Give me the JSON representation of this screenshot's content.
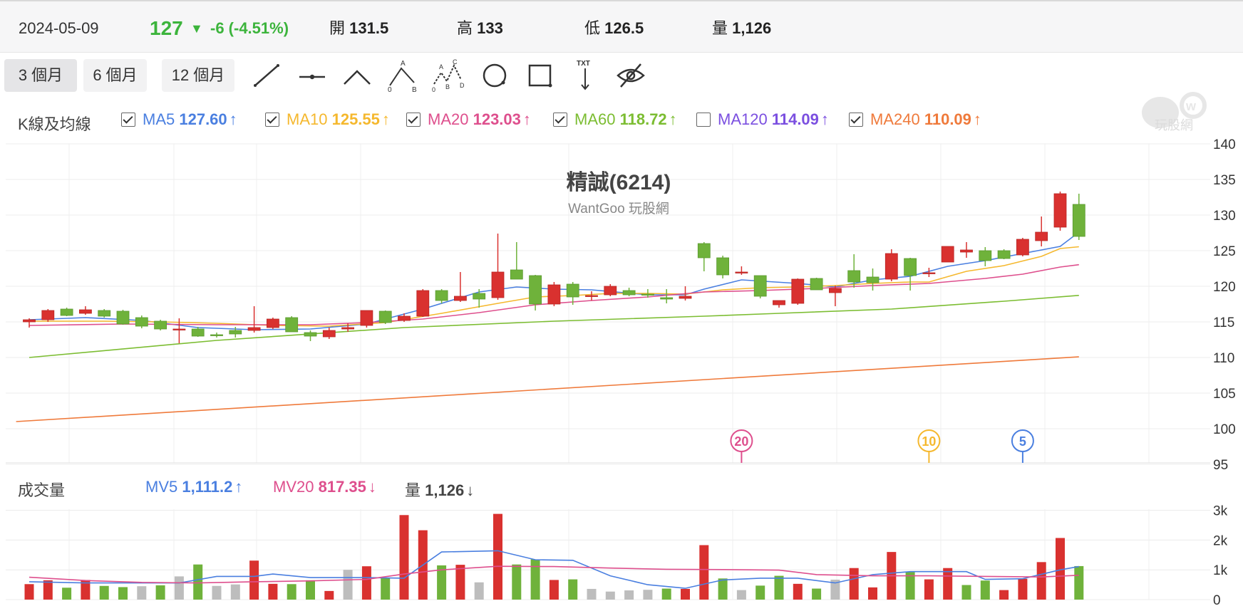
{
  "quote": {
    "date": "2024-05-09",
    "price": "127",
    "change": "-6 (-4.51%)",
    "open_label": "開",
    "open": "131.5",
    "high_label": "高",
    "high": "133",
    "low_label": "低",
    "low": "126.5",
    "volume_label": "量",
    "volume": "1,126"
  },
  "periods": [
    "3 個月",
    "6 個月",
    "12 個月"
  ],
  "active_period": "3 個月",
  "tools": [
    "line-tool-icon",
    "horizontal-line-tool-icon",
    "angle-tool-icon",
    "abc-wave-tool-icon",
    "abcd-wave-tool-icon",
    "circle-tool-icon",
    "rectangle-tool-icon",
    "text-tool-icon",
    "hide-drawings-icon"
  ],
  "tool_labels": {
    "abc": [
      "A",
      "0",
      "B"
    ],
    "abcd": [
      "A",
      "C",
      "0",
      "B",
      "D"
    ],
    "txt": "TXT"
  },
  "ma_legend": {
    "label": "K線及均線",
    "items": [
      {
        "name": "MA5",
        "value": "127.60",
        "color": "#4a7fe0",
        "checked": true,
        "dir": "up"
      },
      {
        "name": "MA10",
        "value": "125.55",
        "color": "#f5b82e",
        "checked": true,
        "dir": "up"
      },
      {
        "name": "MA20",
        "value": "123.03",
        "color": "#de4f8d",
        "checked": true,
        "dir": "up"
      },
      {
        "name": "MA60",
        "value": "118.72",
        "color": "#7cbd32",
        "checked": true,
        "dir": "up"
      },
      {
        "name": "MA120",
        "value": "114.09",
        "color": "#7b4fe0",
        "checked": false,
        "dir": "up"
      },
      {
        "name": "MA240",
        "value": "110.09",
        "color": "#ef7a3b",
        "checked": true,
        "dir": "up"
      }
    ]
  },
  "chart_title": "精誠(6214)",
  "chart_subtitle": "WantGoo 玩股網",
  "watermark": "玩股網",
  "vol_legend": {
    "label": "成交量",
    "items": [
      {
        "name": "MV5",
        "value": "1,111.2",
        "color": "#4a7fe0",
        "dir": "up"
      },
      {
        "name": "MV20",
        "value": "817.35",
        "color": "#de4f8d",
        "dir": "down"
      },
      {
        "name": "量",
        "value": "1,126",
        "color": "#444",
        "dir": "down"
      }
    ]
  },
  "markers": [
    {
      "label": "20",
      "color": "#de4f8d",
      "index": 38
    },
    {
      "label": "10",
      "color": "#f5b82e",
      "index": 48
    },
    {
      "label": "5",
      "color": "#4a7fe0",
      "index": 53
    }
  ],
  "colors": {
    "up": "#d9312f",
    "down": "#6fb23b",
    "flat": "#bdbdbd"
  },
  "chart_data": {
    "type": "candlestick",
    "y_ticks": [
      "140",
      "135",
      "130",
      "125",
      "120",
      "115",
      "110",
      "105",
      "100",
      "95"
    ],
    "ylim": [
      95,
      140
    ],
    "vol_ticks": [
      "3k",
      "2k",
      "1k",
      "0"
    ],
    "vol_ylim": [
      0,
      3000
    ],
    "ohlc": [
      [
        115.0,
        115.5,
        114.2,
        115.3
      ],
      [
        115.3,
        116.8,
        115.0,
        116.6
      ],
      [
        116.8,
        117.0,
        115.8,
        115.9
      ],
      [
        116.2,
        117.2,
        116.0,
        116.7
      ],
      [
        116.6,
        116.8,
        115.6,
        115.8
      ],
      [
        116.5,
        116.7,
        114.6,
        114.7
      ],
      [
        115.6,
        115.9,
        114.1,
        114.4
      ],
      [
        115.1,
        115.3,
        113.8,
        114.0
      ],
      [
        114.0,
        115.5,
        112.0,
        114.0
      ],
      [
        114.0,
        114.3,
        112.9,
        113.0
      ],
      [
        113.2,
        113.5,
        112.8,
        113.1
      ],
      [
        113.8,
        114.3,
        112.8,
        113.3
      ],
      [
        113.8,
        117.2,
        113.5,
        114.2
      ],
      [
        114.2,
        115.6,
        114.0,
        115.4
      ],
      [
        115.6,
        115.8,
        113.6,
        113.6
      ],
      [
        113.5,
        113.8,
        112.3,
        113.0
      ],
      [
        112.9,
        114.2,
        112.6,
        113.8
      ],
      [
        114.0,
        114.8,
        113.6,
        114.2
      ],
      [
        114.5,
        116.6,
        114.2,
        116.6
      ],
      [
        116.5,
        116.6,
        114.7,
        114.9
      ],
      [
        115.2,
        116.2,
        115.0,
        115.8
      ],
      [
        115.8,
        119.6,
        115.7,
        119.4
      ],
      [
        119.4,
        119.6,
        117.6,
        118.0
      ],
      [
        118.0,
        122.0,
        117.8,
        118.6
      ],
      [
        119.0,
        119.6,
        117.0,
        118.2
      ],
      [
        118.4,
        127.4,
        118.1,
        122.0
      ],
      [
        122.3,
        126.2,
        121.3,
        121.0
      ],
      [
        121.5,
        121.6,
        116.6,
        117.5
      ],
      [
        117.5,
        120.6,
        117.2,
        120.2
      ],
      [
        120.3,
        120.6,
        117.4,
        118.5
      ],
      [
        118.7,
        119.3,
        118.0,
        118.7
      ],
      [
        118.8,
        120.3,
        118.6,
        120.0
      ],
      [
        119.4,
        119.8,
        118.6,
        118.8
      ],
      [
        118.9,
        119.6,
        118.4,
        118.8
      ],
      [
        118.4,
        119.6,
        117.6,
        118.2
      ],
      [
        118.3,
        120.0,
        118.0,
        118.6
      ],
      [
        126.0,
        126.2,
        122.1,
        124.0
      ],
      [
        124.0,
        124.3,
        121.1,
        121.6
      ],
      [
        122.0,
        122.8,
        121.6,
        122.0
      ],
      [
        121.5,
        121.5,
        118.3,
        118.6
      ],
      [
        117.4,
        117.9,
        117.0,
        118.0
      ],
      [
        117.6,
        121.1,
        117.4,
        121.0
      ],
      [
        121.1,
        121.2,
        119.8,
        119.5
      ],
      [
        119.1,
        120.1,
        117.2,
        119.7
      ],
      [
        122.2,
        124.5,
        119.8,
        120.6
      ],
      [
        121.3,
        122.5,
        119.4,
        120.5
      ],
      [
        121.0,
        125.2,
        120.7,
        124.6
      ],
      [
        123.9,
        124.0,
        119.4,
        121.5
      ],
      [
        121.8,
        122.6,
        121.3,
        121.9
      ],
      [
        123.4,
        125.6,
        123.4,
        125.6
      ],
      [
        124.8,
        126.2,
        124.0,
        125.1
      ],
      [
        125.0,
        125.5,
        122.8,
        123.6
      ],
      [
        125.0,
        125.2,
        123.8,
        123.9
      ],
      [
        124.4,
        126.8,
        124.2,
        126.6
      ],
      [
        126.4,
        129.8,
        125.6,
        127.6
      ],
      [
        128.3,
        133.3,
        127.8,
        133.0
      ],
      [
        131.5,
        133.0,
        126.5,
        127.0
      ]
    ],
    "volume": [
      {
        "v": 520,
        "c": "up"
      },
      {
        "v": 650,
        "c": "up"
      },
      {
        "v": 400,
        "c": "down"
      },
      {
        "v": 660,
        "c": "up"
      },
      {
        "v": 460,
        "c": "down"
      },
      {
        "v": 420,
        "c": "down"
      },
      {
        "v": 450,
        "c": "flat"
      },
      {
        "v": 480,
        "c": "down"
      },
      {
        "v": 780,
        "c": "flat"
      },
      {
        "v": 1180,
        "c": "down"
      },
      {
        "v": 460,
        "c": "flat"
      },
      {
        "v": 510,
        "c": "flat"
      },
      {
        "v": 1310,
        "c": "up"
      },
      {
        "v": 530,
        "c": "up"
      },
      {
        "v": 520,
        "c": "down"
      },
      {
        "v": 650,
        "c": "down"
      },
      {
        "v": 290,
        "c": "up"
      },
      {
        "v": 1000,
        "c": "flat"
      },
      {
        "v": 1120,
        "c": "up"
      },
      {
        "v": 720,
        "c": "down"
      },
      {
        "v": 2840,
        "c": "up"
      },
      {
        "v": 2330,
        "c": "up"
      },
      {
        "v": 1150,
        "c": "down"
      },
      {
        "v": 1170,
        "c": "up"
      },
      {
        "v": 580,
        "c": "flat"
      },
      {
        "v": 2880,
        "c": "up"
      },
      {
        "v": 1180,
        "c": "down"
      },
      {
        "v": 1350,
        "c": "down"
      },
      {
        "v": 660,
        "c": "up"
      },
      {
        "v": 680,
        "c": "down"
      },
      {
        "v": 360,
        "c": "flat"
      },
      {
        "v": 270,
        "c": "flat"
      },
      {
        "v": 310,
        "c": "flat"
      },
      {
        "v": 330,
        "c": "flat"
      },
      {
        "v": 370,
        "c": "down"
      },
      {
        "v": 360,
        "c": "up"
      },
      {
        "v": 1830,
        "c": "up"
      },
      {
        "v": 710,
        "c": "down"
      },
      {
        "v": 320,
        "c": "flat"
      },
      {
        "v": 470,
        "c": "down"
      },
      {
        "v": 800,
        "c": "down"
      },
      {
        "v": 530,
        "c": "up"
      },
      {
        "v": 370,
        "c": "down"
      },
      {
        "v": 670,
        "c": "flat"
      },
      {
        "v": 1060,
        "c": "up"
      },
      {
        "v": 410,
        "c": "up"
      },
      {
        "v": 1600,
        "c": "up"
      },
      {
        "v": 920,
        "c": "down"
      },
      {
        "v": 680,
        "c": "up"
      },
      {
        "v": 1060,
        "c": "up"
      },
      {
        "v": 490,
        "c": "down"
      },
      {
        "v": 640,
        "c": "down"
      },
      {
        "v": 320,
        "c": "up"
      },
      {
        "v": 700,
        "c": "up"
      },
      {
        "v": 1260,
        "c": "up"
      },
      {
        "v": 2070,
        "c": "up"
      },
      {
        "v": 1126,
        "c": "down"
      }
    ],
    "ma_lines": [
      {
        "name": "MA5",
        "color": "#4a7fe0",
        "points": [
          [
            0,
            115.3
          ],
          [
            3,
            115.6
          ],
          [
            6,
            115.2
          ],
          [
            9,
            114.2
          ],
          [
            12,
            113.9
          ],
          [
            15,
            114.0
          ],
          [
            18,
            114.7
          ],
          [
            21,
            116.8
          ],
          [
            24,
            119.2
          ],
          [
            26,
            119.9
          ],
          [
            28,
            119.6
          ],
          [
            30,
            119.5
          ],
          [
            33,
            118.8
          ],
          [
            35,
            118.8
          ],
          [
            36,
            119.6
          ],
          [
            38,
            120.9
          ],
          [
            41,
            120.4
          ],
          [
            43,
            119.9
          ],
          [
            45,
            120.9
          ],
          [
            47,
            121.4
          ],
          [
            49,
            122.8
          ],
          [
            51,
            123.6
          ],
          [
            53,
            124.6
          ],
          [
            55,
            125.6
          ],
          [
            56,
            127.6
          ]
        ]
      },
      {
        "name": "MA10",
        "color": "#f5b82e",
        "points": [
          [
            0,
            115.1
          ],
          [
            4,
            115.1
          ],
          [
            7,
            115.0
          ],
          [
            10,
            114.8
          ],
          [
            13,
            114.5
          ],
          [
            16,
            114.4
          ],
          [
            19,
            114.9
          ],
          [
            22,
            116.2
          ],
          [
            25,
            117.6
          ],
          [
            27,
            118.5
          ],
          [
            29,
            118.7
          ],
          [
            31,
            119.0
          ],
          [
            33,
            119.0
          ],
          [
            35,
            118.9
          ],
          [
            37,
            119.5
          ],
          [
            39,
            119.8
          ],
          [
            41,
            119.9
          ],
          [
            43,
            120.1
          ],
          [
            45,
            120.4
          ],
          [
            47,
            120.6
          ],
          [
            48,
            120.6
          ],
          [
            50,
            122.1
          ],
          [
            52,
            122.9
          ],
          [
            54,
            124.2
          ],
          [
            55,
            125.3
          ],
          [
            56,
            125.55
          ]
        ]
      },
      {
        "name": "MA20",
        "color": "#de4f8d",
        "points": [
          [
            0,
            114.5
          ],
          [
            5,
            114.7
          ],
          [
            10,
            114.6
          ],
          [
            15,
            114.6
          ],
          [
            18,
            114.9
          ],
          [
            21,
            115.4
          ],
          [
            24,
            116.3
          ],
          [
            27,
            117.4
          ],
          [
            30,
            118.0
          ],
          [
            33,
            118.5
          ],
          [
            36,
            119.2
          ],
          [
            39,
            119.4
          ],
          [
            42,
            119.7
          ],
          [
            45,
            120.1
          ],
          [
            48,
            120.4
          ],
          [
            51,
            121.1
          ],
          [
            53,
            121.7
          ],
          [
            55,
            122.7
          ],
          [
            56,
            123.03
          ]
        ]
      },
      {
        "name": "MA60",
        "color": "#7cbd32",
        "points": [
          [
            0,
            110.0
          ],
          [
            10,
            112.4
          ],
          [
            20,
            114.2
          ],
          [
            28,
            115.1
          ],
          [
            36,
            115.8
          ],
          [
            40,
            116.2
          ],
          [
            46,
            116.8
          ],
          [
            52,
            117.9
          ],
          [
            56,
            118.72
          ]
        ]
      },
      {
        "name": "MA240",
        "color": "#ef7a3b",
        "points": [
          [
            -0.7,
            101.0
          ],
          [
            56,
            110.09
          ]
        ]
      }
    ],
    "mv_lines": [
      {
        "name": "MV5",
        "color": "#4a7fe0",
        "points": [
          [
            0,
            600
          ],
          [
            3,
            560
          ],
          [
            6,
            560
          ],
          [
            8,
            560
          ],
          [
            10,
            780
          ],
          [
            12,
            780
          ],
          [
            13,
            860
          ],
          [
            15,
            740
          ],
          [
            18,
            740
          ],
          [
            20,
            720
          ],
          [
            22,
            1600
          ],
          [
            25,
            1640
          ],
          [
            27,
            1340
          ],
          [
            29,
            1320
          ],
          [
            31,
            800
          ],
          [
            33,
            500
          ],
          [
            35,
            380
          ],
          [
            37,
            660
          ],
          [
            39,
            720
          ],
          [
            41,
            720
          ],
          [
            43,
            560
          ],
          [
            45,
            840
          ],
          [
            47,
            940
          ],
          [
            50,
            940
          ],
          [
            51,
            680
          ],
          [
            53,
            700
          ],
          [
            55,
            1000
          ],
          [
            56,
            1111
          ]
        ]
      },
      {
        "name": "MV20",
        "color": "#de4f8d",
        "points": [
          [
            0,
            750
          ],
          [
            3,
            640
          ],
          [
            6,
            580
          ],
          [
            9,
            560
          ],
          [
            12,
            600
          ],
          [
            15,
            630
          ],
          [
            18,
            680
          ],
          [
            20,
            860
          ],
          [
            22,
            1000
          ],
          [
            25,
            1120
          ],
          [
            28,
            1110
          ],
          [
            31,
            1060
          ],
          [
            34,
            1020
          ],
          [
            37,
            1010
          ],
          [
            40,
            990
          ],
          [
            42,
            840
          ],
          [
            45,
            800
          ],
          [
            48,
            800
          ],
          [
            51,
            780
          ],
          [
            54,
            760
          ],
          [
            56,
            817
          ]
        ]
      }
    ]
  }
}
